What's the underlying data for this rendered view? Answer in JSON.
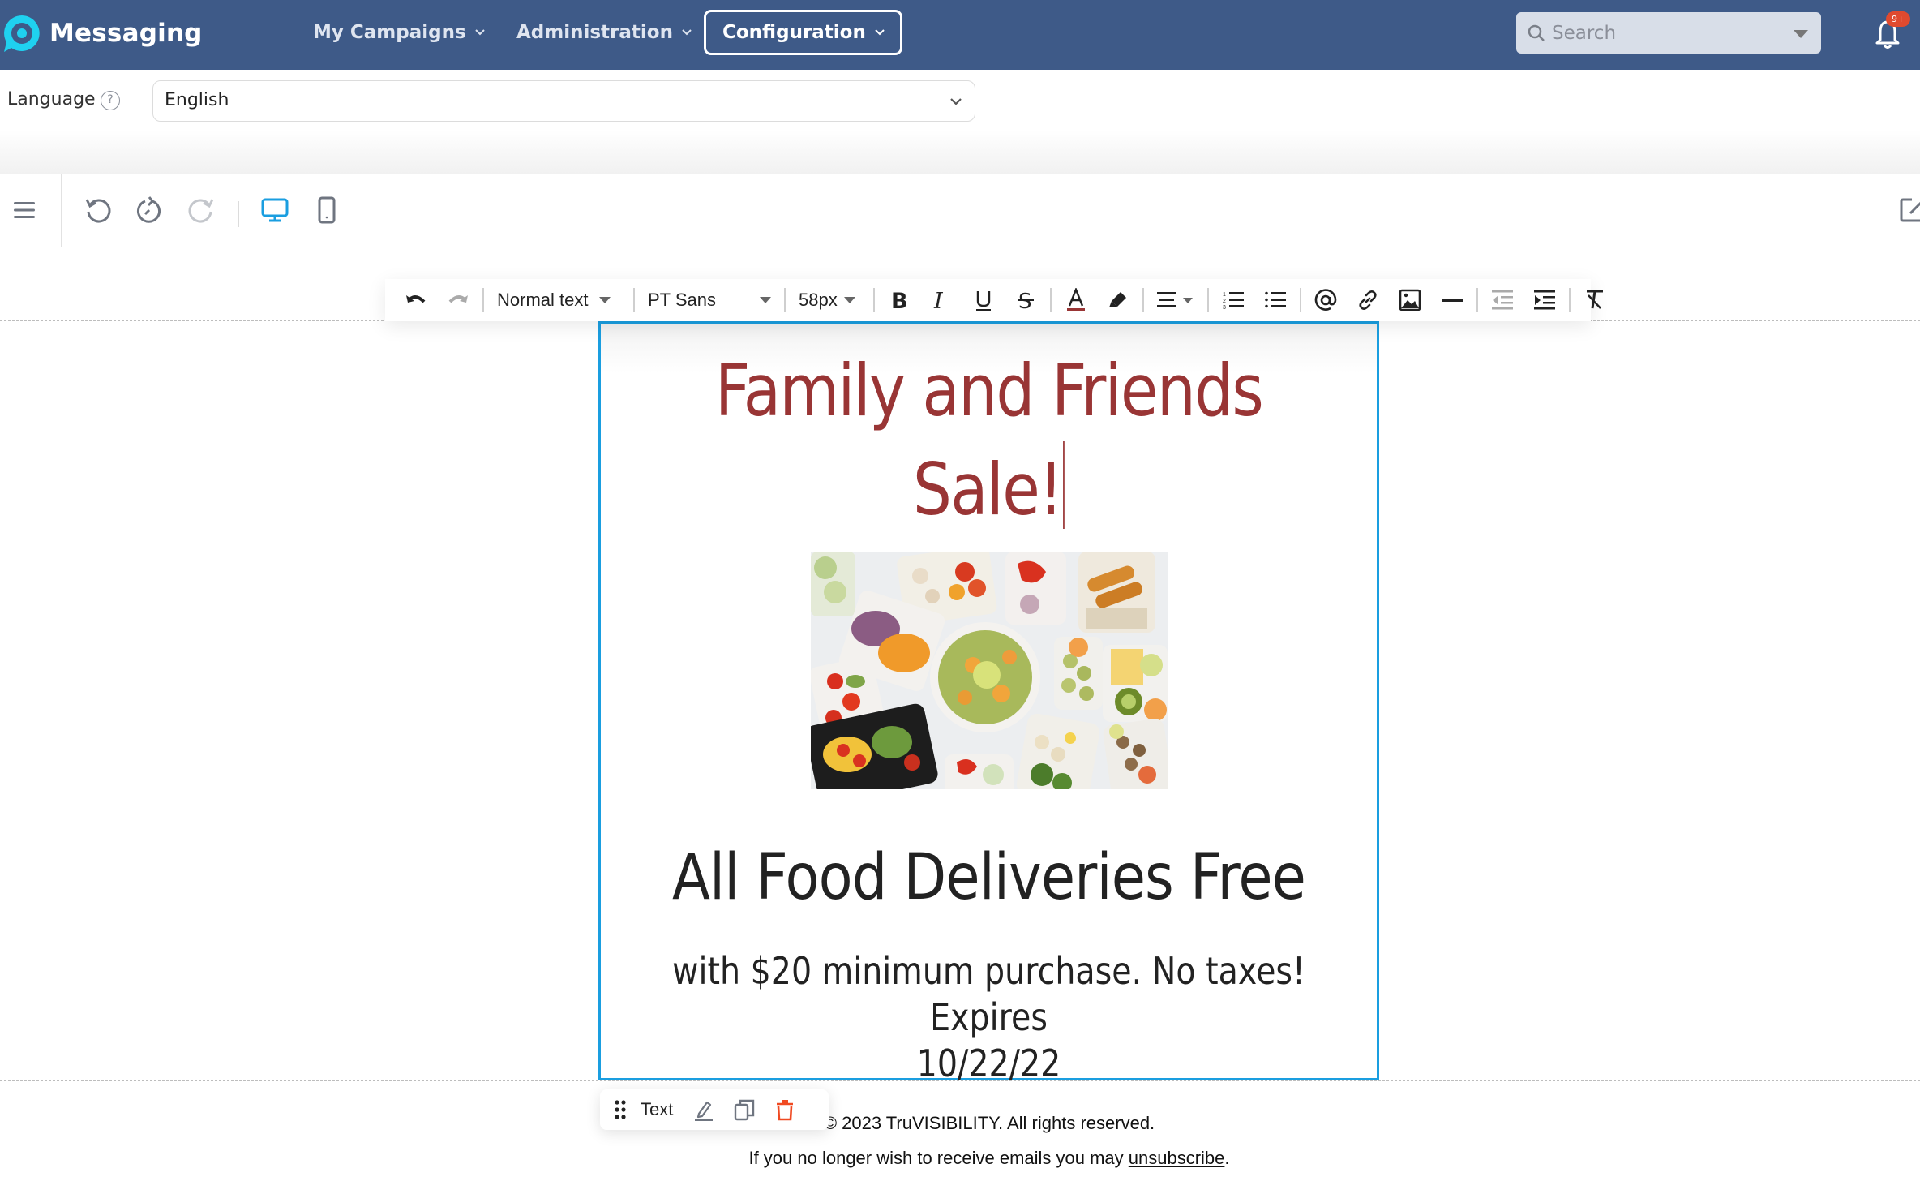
{
  "header": {
    "app_name": "Messaging",
    "nav": [
      {
        "label": "My Campaigns",
        "active": false
      },
      {
        "label": "Administration",
        "active": false
      },
      {
        "label": "Configuration",
        "active": true
      }
    ],
    "search": {
      "placeholder": "Search",
      "value": ""
    },
    "notifications": {
      "badge": "9+"
    },
    "colors": {
      "header_bg": "#3e5a88",
      "logo_accent": "#1fd1f0"
    }
  },
  "language": {
    "label": "Language",
    "help_icon": "question-circle-icon",
    "selected": "English"
  },
  "editor_toolbar": {
    "icons": [
      "menu-icon",
      "undo-history-icon",
      "revert-icon",
      "redo-icon",
      "desktop-view-icon",
      "mobile-view-icon",
      "external-edit-icon"
    ],
    "active_view": "desktop"
  },
  "text_toolbar": {
    "block_style": "Normal text",
    "font_family": "PT Sans",
    "font_size": "58px",
    "buttons": [
      "undo",
      "redo",
      "bold",
      "italic",
      "underline",
      "strikethrough",
      "text-color",
      "highlight",
      "align",
      "ordered-list",
      "unordered-list",
      "mention",
      "link",
      "image",
      "horizontal-rule",
      "outdent",
      "indent",
      "clear-formatting"
    ],
    "text_color": "#993535"
  },
  "content": {
    "headline_line1": "Family and Friends",
    "headline_line2": "Sale!",
    "image_alt": "Assorted healthy meals in containers",
    "sub_headline": "All Food Deliveries Free",
    "sub_text_line1": "with $20 minimum purchase. No taxes! Expires",
    "sub_text_line2": "10/22/22",
    "selection_color": "#1a9ee0"
  },
  "block_bar": {
    "label": "Text",
    "actions": [
      "drag-handle",
      "edit",
      "duplicate",
      "delete"
    ]
  },
  "footer": {
    "copyright": "© 2023 TruVISIBILITY. All rights reserved.",
    "unsubscribe_prefix": "If you no longer wish to receive emails you may ",
    "unsubscribe_link": "unsubscribe",
    "unsubscribe_suffix": "."
  }
}
